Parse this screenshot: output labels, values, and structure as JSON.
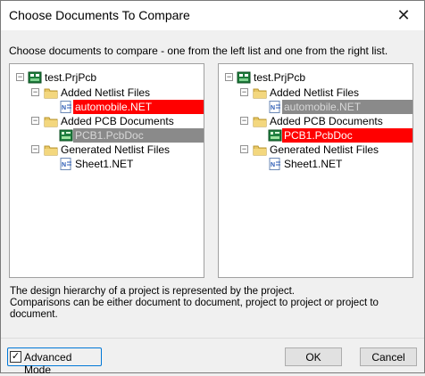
{
  "window": {
    "title": "Choose Documents To Compare",
    "close_glyph": "✕"
  },
  "instructions": "Choose documents to compare - one from the left list and one from the right list.",
  "left_tree": {
    "project": "test.PrjPcb",
    "netlist_folder": "Added Netlist Files",
    "netlist_item": "automobile.NET",
    "pcb_folder": "Added PCB Documents",
    "pcb_item": "PCB1.PcbDoc",
    "generated_folder": "Generated Netlist Files",
    "generated_item": "Sheet1.NET"
  },
  "right_tree": {
    "project": "test.PrjPcb",
    "netlist_folder": "Added Netlist Files",
    "netlist_item": "automobile.NET",
    "pcb_folder": "Added PCB Documents",
    "pcb_item": "PCB1.PcbDoc",
    "generated_folder": "Generated Netlist Files",
    "generated_item": "Sheet1.NET"
  },
  "hint": {
    "line1": "The design hierarchy of a project is represented by the project.",
    "line2": "Comparisons can be either document to document, project to project or project to document."
  },
  "footer": {
    "advanced_mode_label": "Advanced Mode",
    "advanced_mode_checked": true,
    "checkmark": "✓",
    "ok_label": "OK",
    "cancel_label": "Cancel"
  },
  "colors": {
    "selected_red": "#ff0000",
    "disabled_gray": "#8a8a8a",
    "folder": "#e8c766"
  }
}
